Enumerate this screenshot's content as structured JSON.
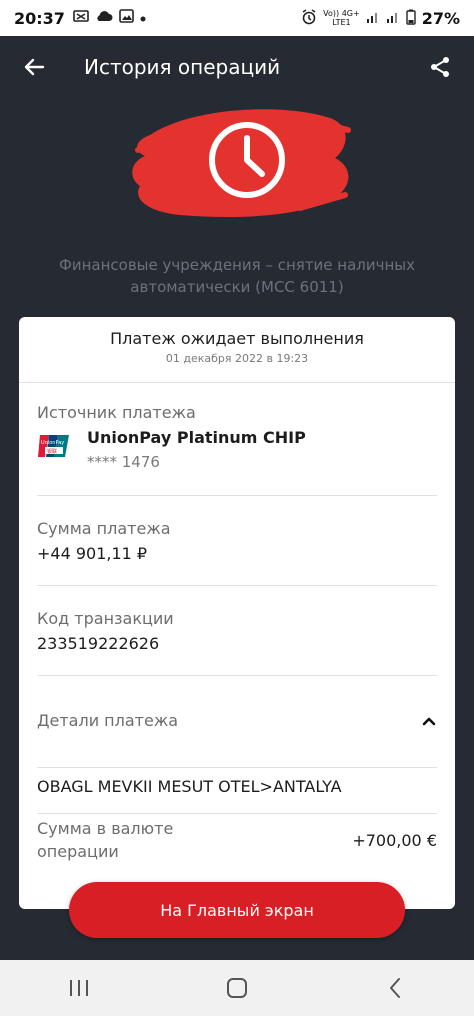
{
  "status_bar": {
    "time": "20:37",
    "battery": "27%",
    "network_top": "Vo)) 4G+",
    "network_bottom": "LTE1"
  },
  "header": {
    "title": "История операций"
  },
  "category": "Финансовые учреждения – снятие наличных автоматически (MCC 6011)",
  "card": {
    "status_title": "Платеж ожидает выполнения",
    "status_date": "01 декабря 2022 в 19:23",
    "source_label": "Источник платежа",
    "source_name": "UnionPay Platinum CHIP",
    "source_mask": "**** 1476",
    "amount_label": "Сумма платежа",
    "amount_value": "+44 901,11 ₽",
    "txn_label": "Код транзакции",
    "txn_value": "233519222626",
    "details_label": "Детали платежа",
    "details_value": "OBAGL MEVKII MESUT OTEL>ANTALYA",
    "currency_label": "Сумма в валюте операции",
    "currency_value": "+700,00 €"
  },
  "main_button": {
    "label": "На Главный экран"
  },
  "colors": {
    "background": "#262b33",
    "accent": "#d81f26",
    "card": "#ffffff"
  },
  "icons": [
    "back-arrow-icon",
    "share-icon",
    "clock-icon",
    "unionpay-logo",
    "chevron-up-icon",
    "recent-apps-icon",
    "home-icon",
    "nav-back-icon"
  ]
}
